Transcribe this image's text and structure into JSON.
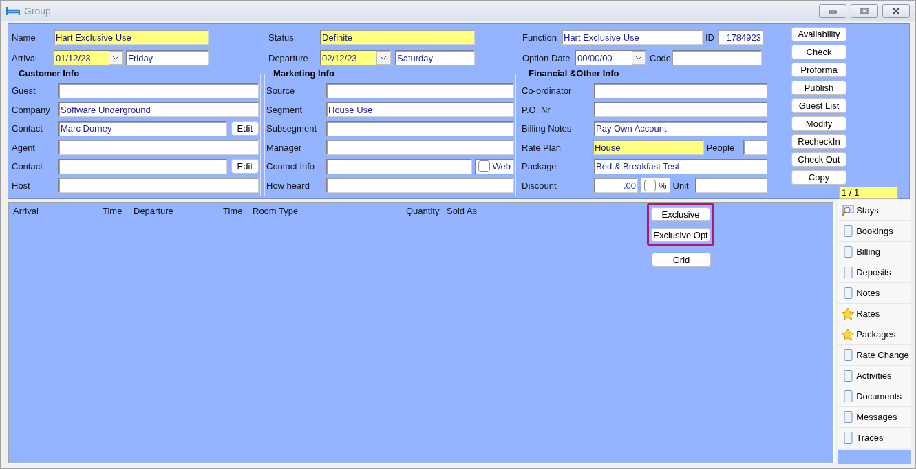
{
  "window": {
    "title": "Group"
  },
  "header": {
    "name": {
      "label": "Name",
      "value": "Hart Exclusive Use",
      "highlighted": true
    },
    "status": {
      "label": "Status",
      "value": "Definite",
      "highlighted": true
    },
    "function": {
      "label": "Function",
      "value": "Hart Exclusive Use",
      "highlighted": false
    },
    "id": {
      "label": "ID",
      "value": "1784923"
    },
    "arrival": {
      "label": "Arrival",
      "date": "01/12/23",
      "day": "Friday",
      "highlighted": true
    },
    "departure": {
      "label": "Departure",
      "date": "02/12/23",
      "day": "Saturday",
      "highlighted": true
    },
    "option_date": {
      "label": "Option Date",
      "date": "00/00/00",
      "highlighted": false
    },
    "code": {
      "label": "Code"
    }
  },
  "groups": [
    {
      "title": "Customer Info",
      "rows": [
        {
          "kind": "text",
          "label": "Guest",
          "highlighted": false
        },
        {
          "kind": "text",
          "label": "Company",
          "value": "Software Underground",
          "highlighted": false
        },
        {
          "kind": "edit",
          "label": "Contact",
          "value": "Marc Dorney",
          "highlighted": false,
          "button": "Edit"
        },
        {
          "kind": "text",
          "label": "Agent",
          "highlighted": false
        },
        {
          "kind": "edit",
          "label": "Contact",
          "highlighted": false,
          "button": "Edit"
        },
        {
          "kind": "text",
          "label": "Host",
          "highlighted": false
        }
      ]
    },
    {
      "title": "Marketing Info",
      "rows": [
        {
          "kind": "text",
          "label": "Source",
          "highlighted": false
        },
        {
          "kind": "text",
          "label": "Segment",
          "value": "House Use",
          "highlighted": false
        },
        {
          "kind": "text",
          "label": "Subsegment",
          "highlighted": false
        },
        {
          "kind": "text",
          "label": "Manager",
          "highlighted": false
        },
        {
          "kind": "check",
          "label": "Contact Info",
          "highlighted": false,
          "check_label": "Web",
          "checked": false
        },
        {
          "kind": "text",
          "label": "How heard",
          "highlighted": false
        }
      ]
    },
    {
      "title": "Financial &Other Info",
      "rows": [
        {
          "kind": "text",
          "label": "Co-ordinator",
          "highlighted": false
        },
        {
          "kind": "text",
          "label": "P.O. Nr",
          "highlighted": false
        },
        {
          "kind": "text",
          "label": "Billing Notes",
          "value": "Pay Own Account",
          "highlighted": false
        },
        {
          "kind": "extra",
          "label": "Rate Plan",
          "value": "House",
          "highlighted": true,
          "extra_label": "People"
        },
        {
          "kind": "text",
          "label": "Package",
          "value": "Bed & Breakfast Test",
          "highlighted": false
        },
        {
          "kind": "discount",
          "label": "Discount",
          "value": ".00",
          "highlighted": false,
          "check_label": "%",
          "checked": false,
          "extra_label": "Unit"
        }
      ]
    }
  ],
  "actions": [
    "Availability",
    "Check",
    "Proforma",
    "Publish",
    "Guest List",
    "Modify",
    "RecheckIn",
    "Check Out",
    "Copy"
  ],
  "page_counter": "1 / 1",
  "table": {
    "columns": [
      "Arrival",
      "Time",
      "Departure",
      "Time",
      "Room Type",
      "Quantity",
      "Sold As"
    ]
  },
  "framed_buttons": [
    "Exclusive",
    "Exclusive Opt"
  ],
  "grid_buttons": [
    "Grid"
  ],
  "side_tabs": [
    {
      "label": "Stays",
      "kind": "search"
    },
    {
      "label": "Bookings",
      "kind": "page"
    },
    {
      "label": "Billing",
      "kind": "page"
    },
    {
      "label": "Deposits",
      "kind": "page"
    },
    {
      "label": "Notes",
      "kind": "page"
    },
    {
      "label": "Rates",
      "kind": "star"
    },
    {
      "label": "Packages",
      "kind": "star"
    },
    {
      "label": "Rate Change",
      "kind": "page"
    },
    {
      "label": "Activities",
      "kind": "page"
    },
    {
      "label": "Documents",
      "kind": "page"
    },
    {
      "label": "Messages",
      "kind": "page"
    },
    {
      "label": "Traces",
      "kind": "page"
    }
  ]
}
